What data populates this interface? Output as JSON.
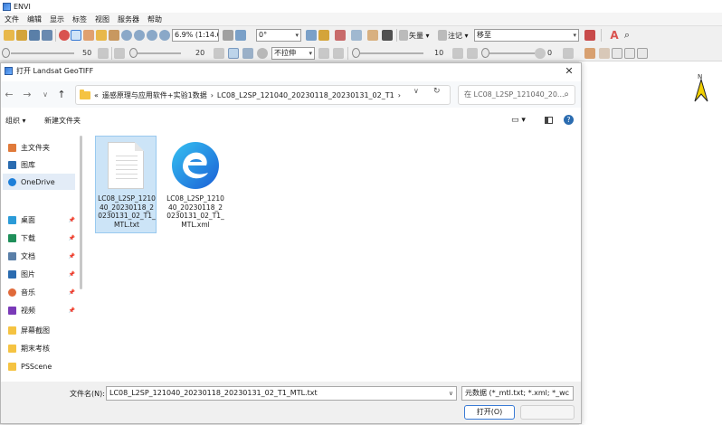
{
  "app": {
    "title": "ENVI"
  },
  "menu": [
    "文件",
    "编辑",
    "显示",
    "标签",
    "视图",
    "服务器",
    "帮助"
  ],
  "toolbar1": {
    "zoom": "6.9% (1:14.6)",
    "rotation": "0°",
    "vector_label": "矢量",
    "annotation_label": "注记",
    "goto_value": "移至"
  },
  "toolbar2": {
    "brightness": "50",
    "contrast": "20",
    "stretch": "不拉伸",
    "sharpen": "10",
    "transparency": "0"
  },
  "dialog": {
    "title": "打开 Landsat GeoTIFF",
    "breadcrumb_prefix": "«",
    "breadcrumb": [
      "遥感原理与应用软件+实验1数据",
      "LC08_L2SP_121040_20230118_20230131_02_T1"
    ],
    "search_placeholder": "在 LC08_L2SP_121040_20...",
    "organize": "组织 ▾",
    "new_folder": "新建文件夹",
    "nav_items": [
      {
        "label": "主文件夹",
        "icon": "home-icon",
        "color": "#e07a3a"
      },
      {
        "label": "图库",
        "icon": "gallery-icon",
        "color": "#2b6cb0"
      },
      {
        "label": "OneDrive",
        "icon": "cloud-icon",
        "color": "#1e7fd8"
      },
      {
        "label": "桌面",
        "icon": "desktop-icon",
        "color": "#2b9bd8"
      },
      {
        "label": "下载",
        "icon": "download-icon",
        "color": "#1f8f5a"
      },
      {
        "label": "文档",
        "icon": "document-icon",
        "color": "#5a7fa8"
      },
      {
        "label": "图片",
        "icon": "pictures-icon",
        "color": "#2b6cb0"
      },
      {
        "label": "音乐",
        "icon": "music-icon",
        "color": "#e06a3a"
      },
      {
        "label": "视频",
        "icon": "video-icon",
        "color": "#7a3ab8"
      },
      {
        "label": "屏幕截图",
        "icon": "folder-icon",
        "color": "#f5c342"
      },
      {
        "label": "期末考核",
        "icon": "folder-icon",
        "color": "#f5c342"
      },
      {
        "label": "PSScene",
        "icon": "folder-icon",
        "color": "#f5c342"
      }
    ],
    "files": [
      {
        "name": "LC08_L2SP_121040_20230118_20230131_02_T1_MTL.txt",
        "icon": "text-file-icon",
        "selected": true
      },
      {
        "name": "LC08_L2SP_121040_20230118_20230131_02_T1_MTL.xml",
        "icon": "edge-file-icon",
        "selected": false
      }
    ],
    "filename_label": "文件名(N):",
    "filename_value": "LC08_L2SP_121040_20230118_20230131_02_T1_MTL.txt",
    "filter": "元数据 (*_mtl.txt; *.xml; *_wc",
    "open_button": "打开(O)",
    "cancel_button": ""
  }
}
